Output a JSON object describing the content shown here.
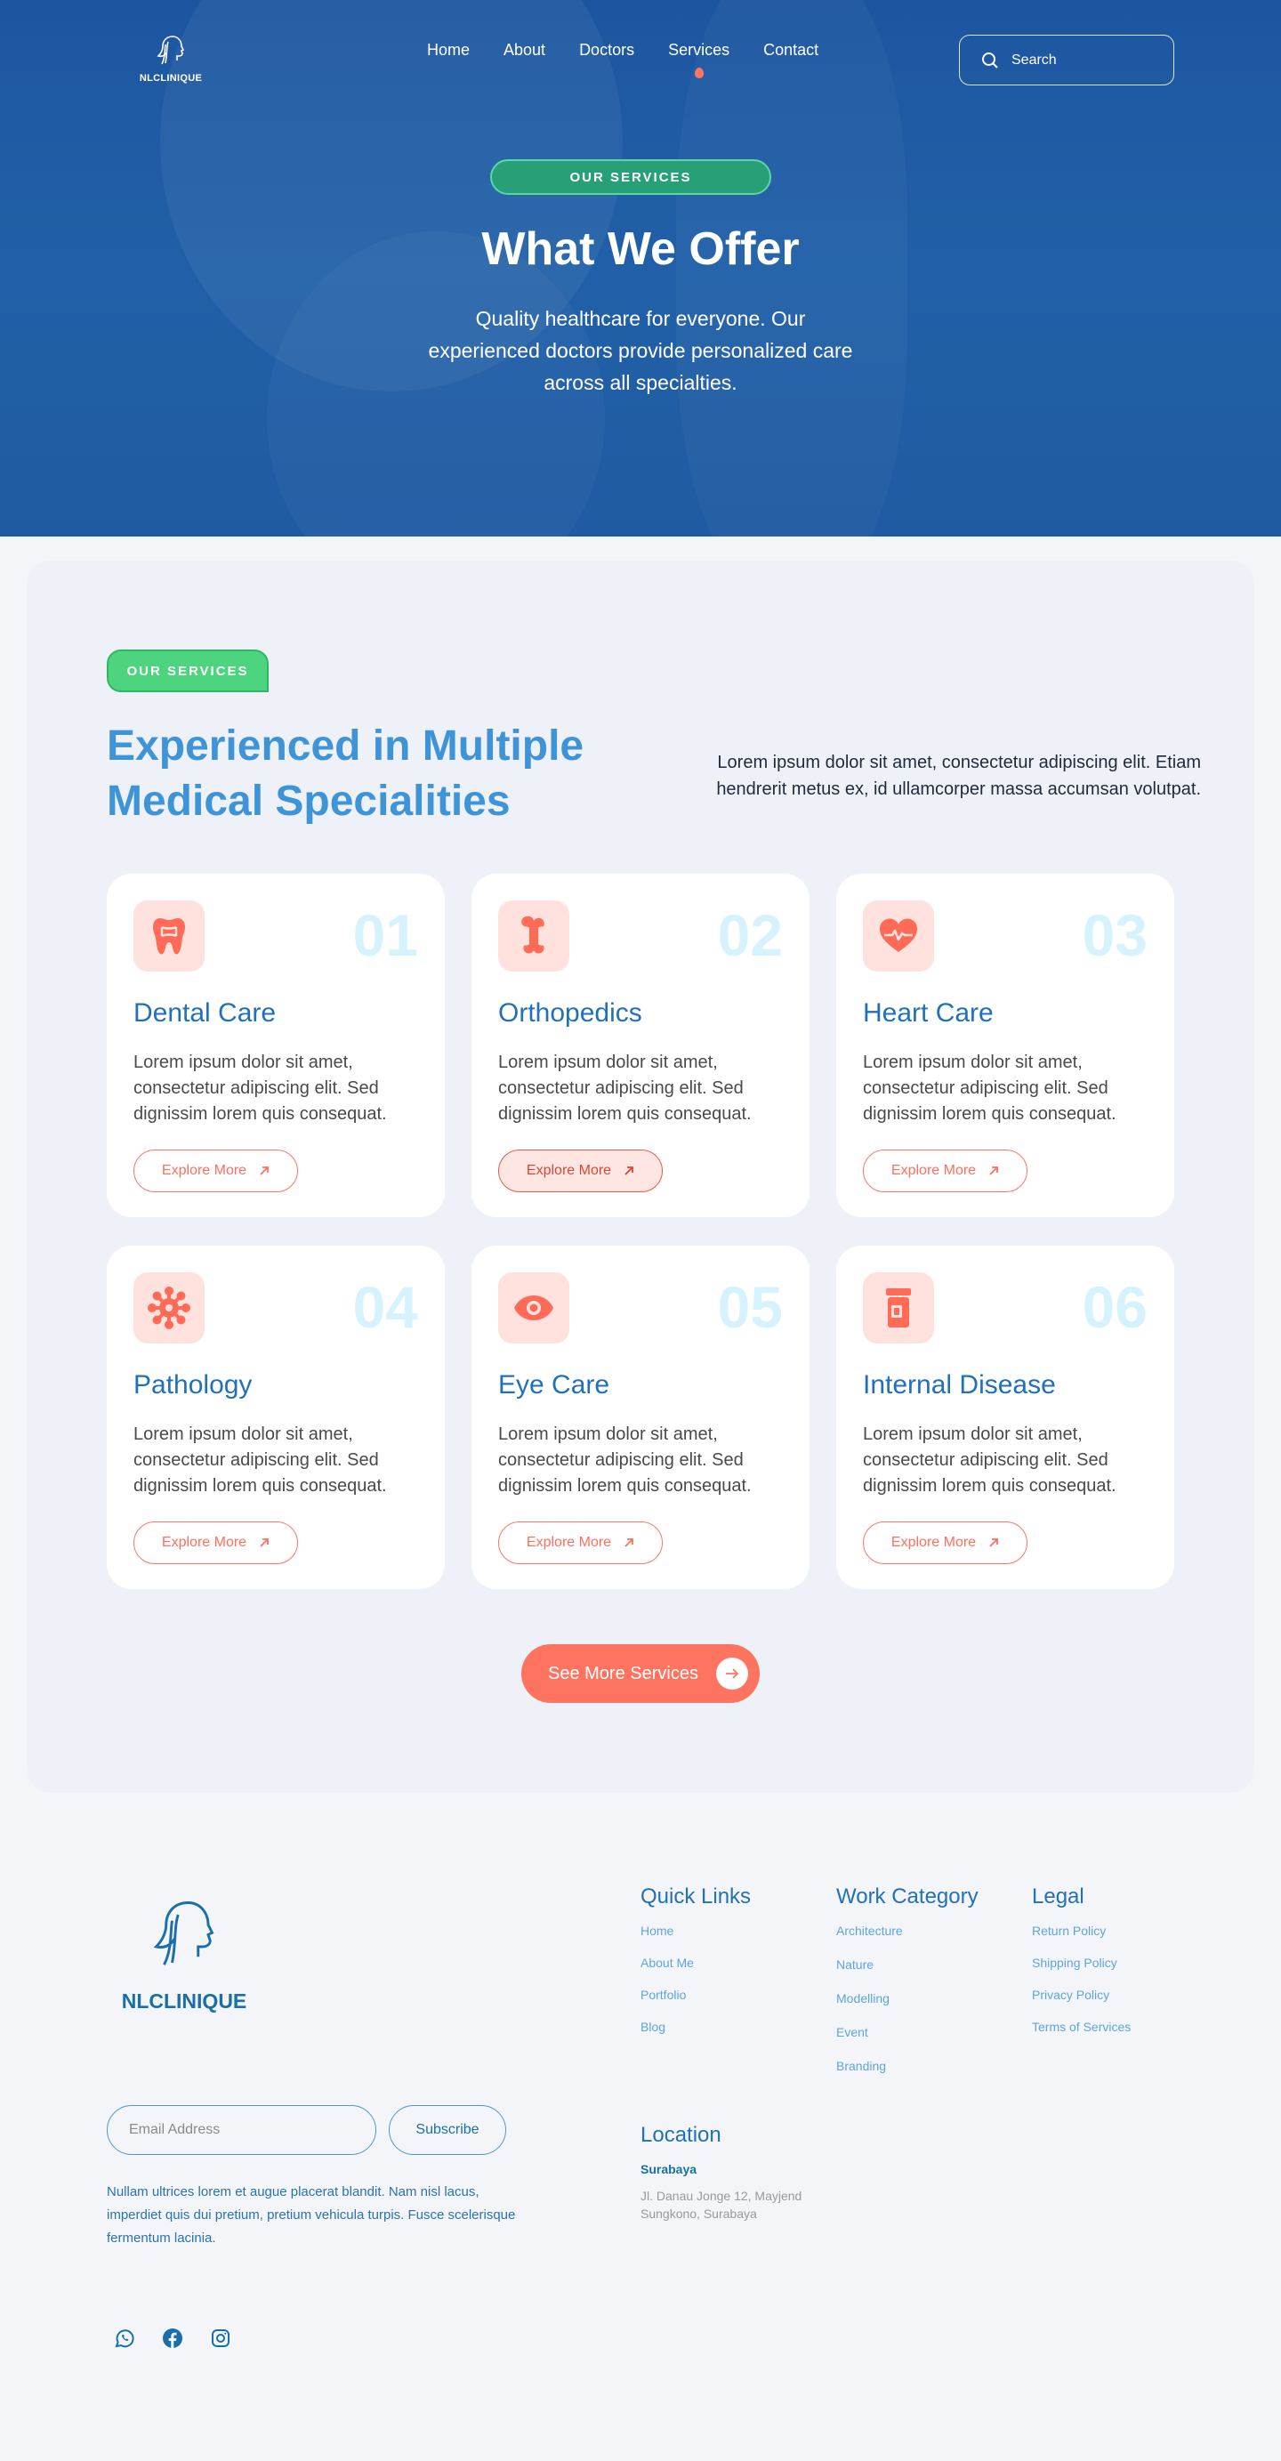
{
  "brand": {
    "name": "NLCLINIQUE"
  },
  "nav": {
    "links": [
      {
        "label": "Home"
      },
      {
        "label": "About"
      },
      {
        "label": "Doctors"
      },
      {
        "label": "Services",
        "active": true
      },
      {
        "label": "Contact"
      }
    ],
    "search_placeholder": "Search"
  },
  "hero": {
    "badge": "OUR SERVICES",
    "title": "What We Offer",
    "subtitle": "Quality healthcare for everyone. Our experienced doctors provide personalized care across all specialties."
  },
  "services": {
    "badge": "OUR SERVICES",
    "title": "Experienced in Multiple Medical Specialities",
    "description": "Lorem ipsum dolor sit amet, consectetur adipiscing elit. Etiam hendrerit metus ex, id ullamcorper massa accumsan volutpat.",
    "cards": [
      {
        "number": "01",
        "title": "Dental Care",
        "text": "Lorem ipsum dolor sit amet, consectetur adipiscing elit. Sed dignissim lorem quis consequat.",
        "button": "Explore More",
        "icon": "tooth-icon"
      },
      {
        "number": "02",
        "title": "Orthopedics",
        "text": "Lorem ipsum dolor sit amet, consectetur adipiscing elit. Sed dignissim lorem quis consequat.",
        "button": "Explore More",
        "icon": "bone-icon"
      },
      {
        "number": "03",
        "title": "Heart Care",
        "text": "Lorem ipsum dolor sit amet, consectetur adipiscing elit. Sed dignissim lorem quis consequat.",
        "button": "Explore More",
        "icon": "heart-pulse-icon"
      },
      {
        "number": "04",
        "title": "Pathology",
        "text": "Lorem ipsum dolor sit amet, consectetur adipiscing elit. Sed dignissim lorem quis consequat.",
        "button": "Explore More",
        "icon": "virus-icon"
      },
      {
        "number": "05",
        "title": "Eye Care",
        "text": "Lorem ipsum dolor sit amet, consectetur adipiscing elit. Sed dignissim lorem quis consequat.",
        "button": "Explore More",
        "icon": "eye-icon"
      },
      {
        "number": "06",
        "title": "Internal Disease",
        "text": "Lorem ipsum dolor sit amet, consectetur adipiscing elit. Sed dignissim lorem quis consequat.",
        "button": "Explore More",
        "icon": "pill-bottle-icon"
      }
    ],
    "see_more": "See More Services"
  },
  "footer": {
    "email_placeholder": "Email Address",
    "subscribe": "Subscribe",
    "text": "Nullam ultrices lorem et augue placerat blandit. Nam nisl lacus, imperdiet quis dui pretium, pretium vehicula turpis. Fusce scelerisque fermentum lacinia.",
    "quick_links": {
      "title": "Quick Links",
      "items": [
        "Home",
        "About Me",
        "Portfolio",
        "Blog"
      ]
    },
    "work_category": {
      "title": "Work Category",
      "items": [
        "Architecture",
        "Nature",
        "Modelling",
        "Event",
        "Branding"
      ]
    },
    "legal": {
      "title": "Legal",
      "items": [
        "Return Policy",
        "Shipping Policy",
        "Privacy Policy",
        "Terms of Services"
      ]
    },
    "location": {
      "title": "Location",
      "city": "Surabaya",
      "address": "Jl. Danau Jonge 12, Mayjend Sungkono, Surabaya"
    },
    "socials": [
      "whatsapp-icon",
      "facebook-icon",
      "instagram-icon"
    ]
  },
  "colors": {
    "hero_bg": "#1d56a0",
    "accent_coral": "#ff7461",
    "heading_blue": "#3e94d6",
    "badge_green": "#4cd47e"
  }
}
